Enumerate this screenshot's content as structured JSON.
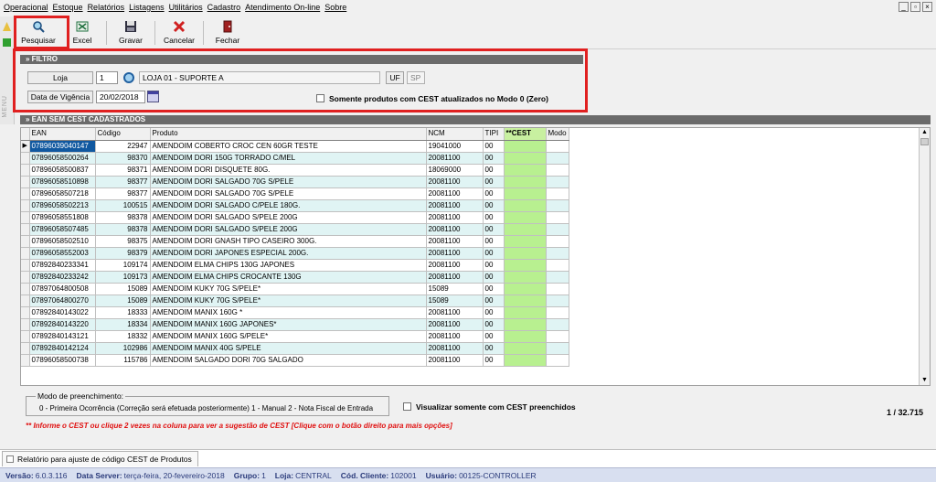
{
  "menu": [
    "Operacional",
    "Estoque",
    "Relatórios",
    "Listagens",
    "Utilitários",
    "Cadastro",
    "Atendimento On-line",
    "Sobre"
  ],
  "window_controls": [
    "_",
    "▫",
    "×"
  ],
  "toolbar": {
    "search_label": "Pesquisar",
    "excel_label": "Excel",
    "save_label": "Gravar",
    "cancel_label": "Cancelar",
    "close_label": "Fechar"
  },
  "side_label": "MENU",
  "filter": {
    "header": "» FILTRO",
    "loja_label": "Loja",
    "loja_code": "1",
    "loja_name": "LOJA 01 - SUPORTE A",
    "uf_label": "UF",
    "uf_value": "SP",
    "date_label": "Data de Vigência",
    "date_value": "20/02/2018",
    "checkbox_label": "Somente produtos com CEST atualizados no Modo 0 (Zero)"
  },
  "grid": {
    "header": "» EAN SEM CEST CADASTRADOS",
    "columns": [
      "EAN",
      "Código",
      "Produto",
      "NCM",
      "TIPI",
      "**CEST",
      "Modo"
    ],
    "rows": [
      [
        "07896039040147",
        "22947",
        "AMENDOIM  COBERTO CROC CEN 60GR TESTE",
        "19041000",
        "00",
        "",
        ""
      ],
      [
        "07896058500264",
        "98370",
        "AMENDOIM DORI  150G TORRADO C/MEL",
        "20081100",
        "00",
        "",
        ""
      ],
      [
        "07896058500837",
        "98371",
        "AMENDOIM DORI  DISQUETE 80G.",
        "18069000",
        "00",
        "",
        ""
      ],
      [
        "07896058510898",
        "98377",
        "AMENDOIM DORI  SALGADO  70G S/PELE",
        "20081100",
        "00",
        "",
        ""
      ],
      [
        "07896058507218",
        "98377",
        "AMENDOIM DORI  SALGADO  70G S/PELE",
        "20081100",
        "00",
        "",
        ""
      ],
      [
        "07896058502213",
        "100515",
        "AMENDOIM DORI  SALGADO C/PELE 180G.",
        "20081100",
        "00",
        "",
        ""
      ],
      [
        "07896058551808",
        "98378",
        "AMENDOIM DORI  SALGADO S/PELE 200G",
        "20081100",
        "00",
        "",
        ""
      ],
      [
        "07896058507485",
        "98378",
        "AMENDOIM DORI  SALGADO S/PELE 200G",
        "20081100",
        "00",
        "",
        ""
      ],
      [
        "07896058502510",
        "98375",
        "AMENDOIM DORI GNASH TIPO CASEIRO 300G.",
        "20081100",
        "00",
        "",
        ""
      ],
      [
        "07896058552003",
        "98379",
        "AMENDOIM DORI JAPONES ESPECIAL 200G.",
        "20081100",
        "00",
        "",
        ""
      ],
      [
        "07892840233341",
        "109174",
        "AMENDOIM ELMA CHIPS  130G JAPONES",
        "20081100",
        "00",
        "",
        ""
      ],
      [
        "07892840233242",
        "109173",
        "AMENDOIM ELMA CHIPS CROCANTE  130G",
        "20081100",
        "00",
        "",
        ""
      ],
      [
        "07897064800508",
        "15089",
        "AMENDOIM KUKY 70G S/PELE*",
        "15089",
        "00",
        "",
        ""
      ],
      [
        "07897064800270",
        "15089",
        "AMENDOIM KUKY 70G S/PELE*",
        "15089",
        "00",
        "",
        ""
      ],
      [
        "07892840143022",
        "18333",
        "AMENDOIM MANIX 160G *",
        "20081100",
        "00",
        "",
        ""
      ],
      [
        "07892840143220",
        "18334",
        "AMENDOIM MANIX 160G JAPONES*",
        "20081100",
        "00",
        "",
        ""
      ],
      [
        "07892840143121",
        "18332",
        "AMENDOIM MANIX 160G S/PELE*",
        "20081100",
        "00",
        "",
        ""
      ],
      [
        "07892840142124",
        "102986",
        "AMENDOIM MANIX 40G S/PELE",
        "20081100",
        "00",
        "",
        ""
      ],
      [
        "07896058500738",
        "115786",
        "AMENDOIM SALGADO DORI 70G SALGADO",
        "20081100",
        "00",
        "",
        ""
      ]
    ]
  },
  "modo": {
    "legend": "Modo de preenchimento:",
    "text": "0 - Primeira Ocorrência (Correção será efetuada posteriormente)     1 - Manual     2 - Nota Fiscal de Entrada"
  },
  "visualizar_label": "Visualizar somente com CEST preenchidos",
  "pager": "1 / 32.715",
  "note": "** Informe o CEST ou clique 2 vezes na coluna para ver a sugestão de CEST     [Clique com o botão direito para mais opções]",
  "tab_label": "Relatório para ajuste de código CEST de Produtos",
  "status": [
    {
      "k": "Versão:",
      "v": "6.0.3.116"
    },
    {
      "k": "Data Server:",
      "v": "terça-feira, 20-fevereiro-2018"
    },
    {
      "k": "Grupo:",
      "v": "1"
    },
    {
      "k": "Loja:",
      "v": "CENTRAL"
    },
    {
      "k": "Cód. Cliente:",
      "v": "102001"
    },
    {
      "k": "Usuário:",
      "v": "00125-CONTROLLER"
    }
  ],
  "colors": {
    "highlight": "#e02020",
    "cest_column": "#b8f090",
    "row_alt": "#e0f4f4",
    "selected_cell": "#1058a0"
  }
}
